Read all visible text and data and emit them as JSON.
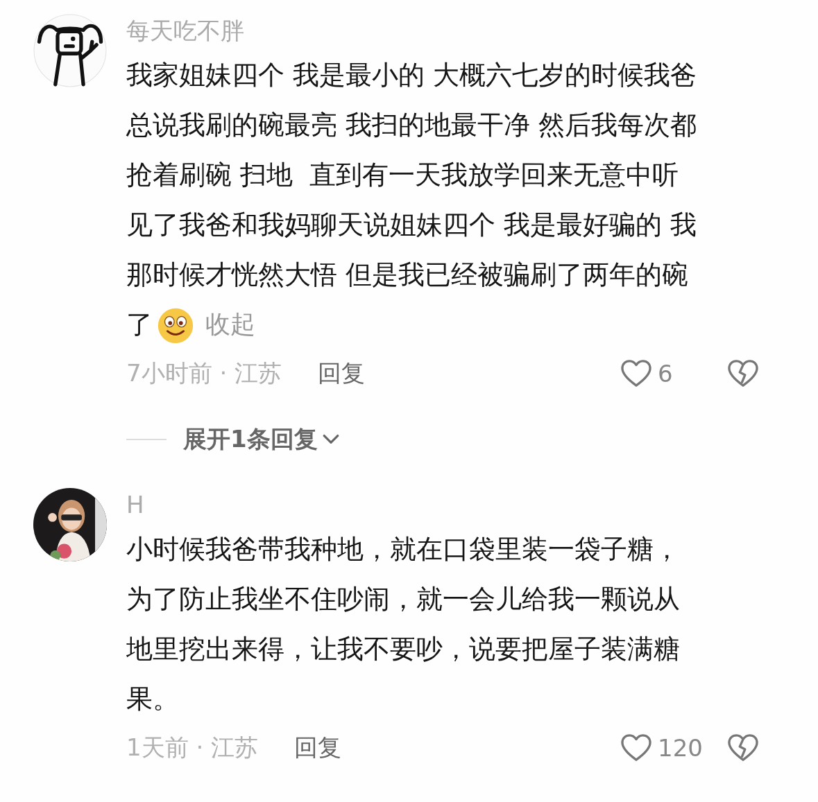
{
  "comments": [
    {
      "avatar": {
        "kind": "drawing"
      },
      "username": "每天吃不胖",
      "lines": [
        "我家姐妹四个 我是最小的 大概六七岁的时候我爸",
        "总说我刷的碗最亮 我扫的地最干净 然后我每次都",
        "抢着刷碗 扫地  直到有一天我放学回来无意中听",
        "见了我爸和我妈聊天说姐妹四个 我是最好骗的 我",
        "那时候才恍然大悟 但是我已经被骗刷了两年的碗",
        "了"
      ],
      "emoji": true,
      "collapse_label": "收起",
      "time_location": "7小时前 · 江苏",
      "reply_label": "回复",
      "likes": "6",
      "expand_replies": "展开1条回复"
    },
    {
      "username": "H",
      "lines": [
        "小时候我爸带我种地，就在口袋里装一袋子糖，",
        "为了防止我坐不住吵闹，就一会儿给我一颗说从",
        "地里挖出来得，让我不要吵，说要把屋子装满糖",
        "果。"
      ],
      "time_location": "1天前 · 江苏",
      "reply_label": "回复",
      "likes": "120"
    }
  ]
}
